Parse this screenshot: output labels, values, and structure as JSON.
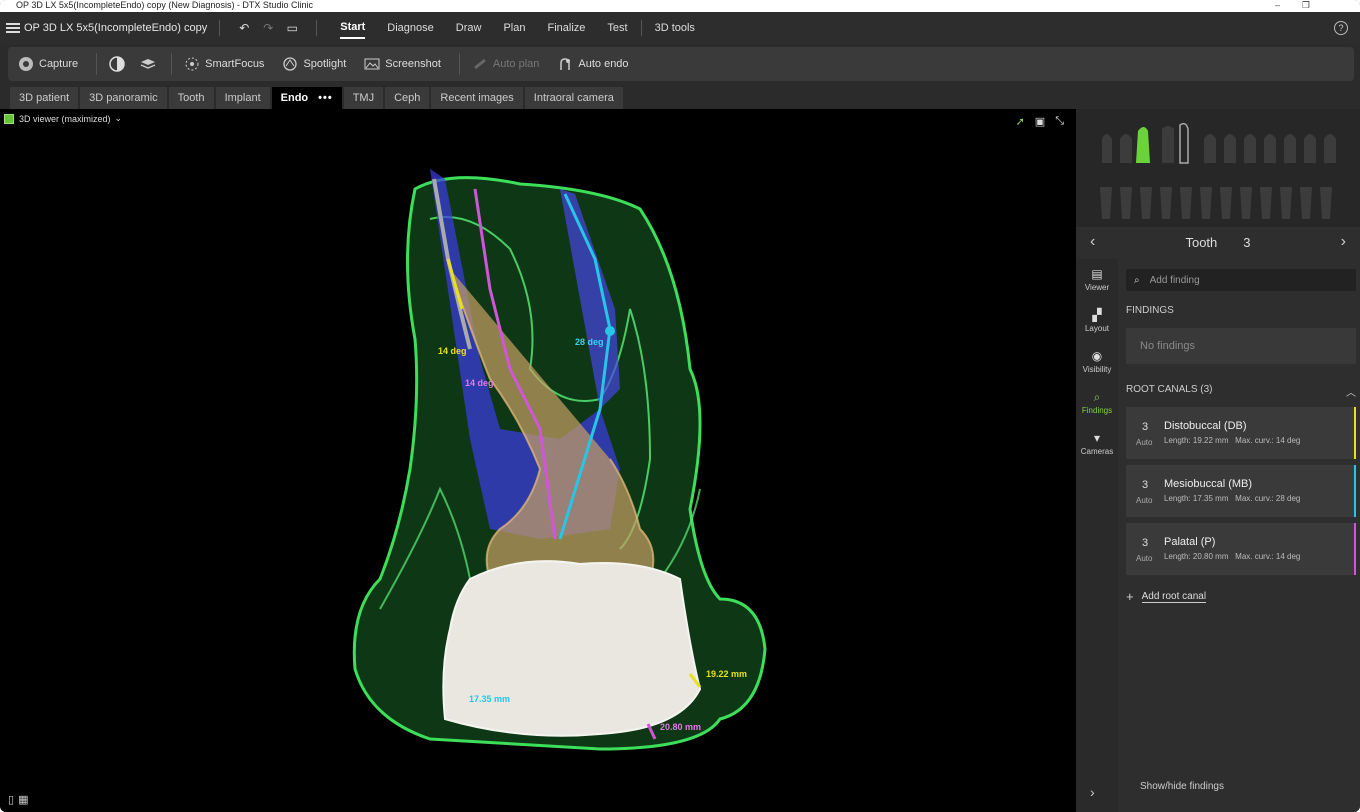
{
  "window": {
    "title_bar_text": "OP 3D LX 5x5(IncompleteEndo) copy (New Diagnosis) - DTX Studio Clinic",
    "minimize": "–",
    "maximize": "❐"
  },
  "menubar": {
    "doc_title": "OP 3D LX 5x5(IncompleteEndo) copy",
    "items": [
      "Start",
      "Diagnose",
      "Draw",
      "Plan",
      "Finalize",
      "Test",
      "3D tools"
    ],
    "active": "Start",
    "help": "?"
  },
  "toolbar": {
    "capture": "Capture",
    "smartfocus": "SmartFocus",
    "spotlight": "Spotlight",
    "screenshot": "Screenshot",
    "auto_plan": "Auto plan",
    "auto_endo": "Auto endo"
  },
  "tabs": [
    "3D patient",
    "3D panoramic",
    "Tooth",
    "Implant",
    "Endo",
    "TMJ",
    "Ceph",
    "Recent images",
    "Intraoral camera"
  ],
  "active_tab": "Endo",
  "tab_more": "•••",
  "viewer": {
    "title": "3D viewer (maximized)",
    "measurements": {
      "db_angle": "14 deg",
      "p_angle": "14 deg",
      "mb_angle": "28 deg",
      "db_length": "19.22 mm",
      "mb_length": "17.35 mm",
      "p_length": "20.80 mm"
    }
  },
  "panel": {
    "tooth_label": "Tooth",
    "tooth_number": "3",
    "side_tabs": [
      "Viewer",
      "Layout",
      "Visibility",
      "Findings",
      "Cameras"
    ],
    "active_side_tab": "Findings",
    "search_placeholder": "Add finding",
    "findings_title": "FINDINGS",
    "no_findings": "No findings",
    "root_canals_title": "ROOT CANALS (3)",
    "canals": [
      {
        "num": "3",
        "auto": "Auto",
        "name": "Distobuccal (DB)",
        "length": "Length: 19.22 mm",
        "curv": "Max. curv.: 14 deg",
        "color": "#e8e01a"
      },
      {
        "num": "3",
        "auto": "Auto",
        "name": "Mesiobuccal (MB)",
        "length": "Length: 17.35 mm",
        "curv": "Max. curv.: 28 deg",
        "color": "#27c6e6"
      },
      {
        "num": "3",
        "auto": "Auto",
        "name": "Palatal (P)",
        "length": "Length: 20.80 mm",
        "curv": "Max. curv.: 14 deg",
        "color": "#d056d8"
      }
    ],
    "add_root_canal": "Add root canal",
    "show_hide": "Show/hide findings"
  }
}
